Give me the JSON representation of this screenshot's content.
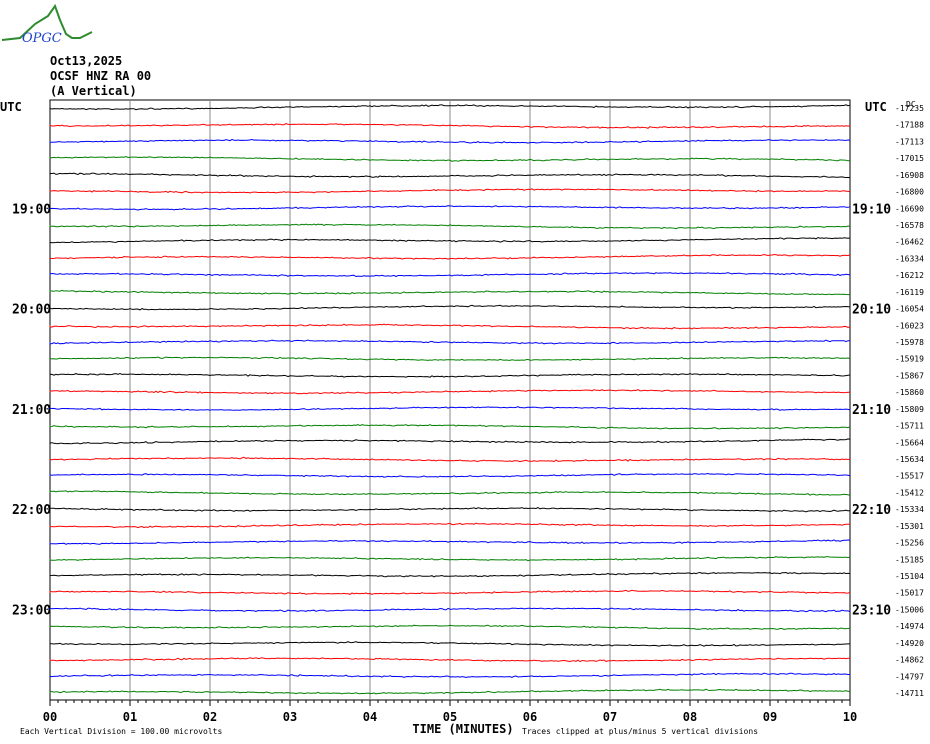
{
  "logo_text": "OPGC",
  "header": {
    "date": "Oct13,2025",
    "station": "OCSF HNZ RA 00",
    "component": "(A Vertical)"
  },
  "chart_data": {
    "type": "line",
    "title": "Helicorder OCSF HNZ RA 00 Oct13,2025",
    "xlabel": "TIME (MINUTES)",
    "x_ticks": [
      "00",
      "01",
      "02",
      "03",
      "04",
      "05",
      "06",
      "07",
      "08",
      "09",
      "10"
    ],
    "xlim": [
      0,
      10
    ],
    "left_axis_title": "UTC",
    "right_axis_title": "UTC",
    "dc_label": "DC",
    "left_hour_labels": [
      {
        "row": 6,
        "label": "19:00"
      },
      {
        "row": 12,
        "label": "20:00"
      },
      {
        "row": 18,
        "label": "21:00"
      },
      {
        "row": 24,
        "label": "22:00"
      },
      {
        "row": 30,
        "label": "23:00"
      }
    ],
    "right_hour_labels": [
      {
        "row": 6,
        "label": "19:10"
      },
      {
        "row": 12,
        "label": "20:10"
      },
      {
        "row": 18,
        "label": "21:10"
      },
      {
        "row": 24,
        "label": "22:10"
      },
      {
        "row": 30,
        "label": "23:10"
      }
    ],
    "trace_colors": [
      "#000000",
      "#ff0000",
      "#0000ff",
      "#008000"
    ],
    "dc_offsets": [
      "-17235",
      "-17188",
      "-17113",
      "-17015",
      "-16908",
      "-16800",
      "-16690",
      "-16578",
      "-16462",
      "-16334",
      "-16212",
      "-16119",
      "-16054",
      "-16023",
      "-15978",
      "-15919",
      "-15867",
      "-15860",
      "-15809",
      "-15711",
      "-15664",
      "-15634",
      "-15517",
      "-15412",
      "-15334",
      "-15301",
      "-15256",
      "-15185",
      "-15104",
      "-15017",
      "-15006",
      "-14974",
      "-14920",
      "-14862",
      "-14797",
      "-14711"
    ],
    "scale_note": "Each Vertical Division =  100.00 microvolts",
    "clip_note": "Traces clipped at plus/minus 5 vertical divisions"
  }
}
